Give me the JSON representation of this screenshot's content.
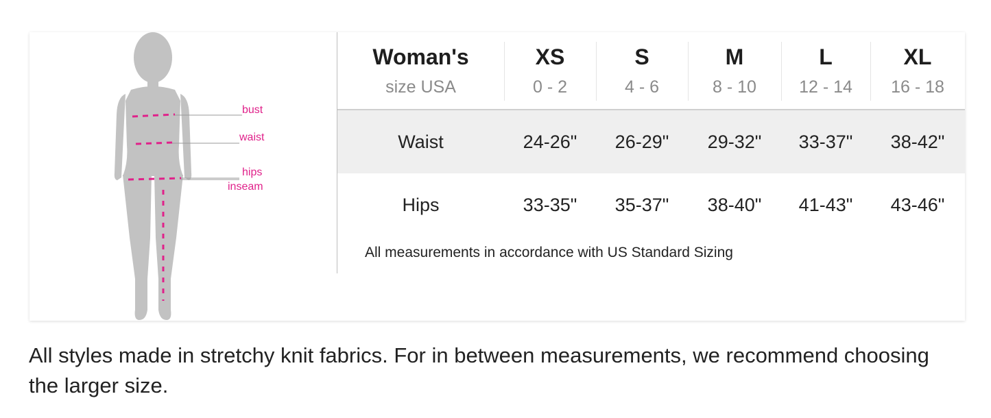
{
  "figure": {
    "labels": {
      "bust": "bust",
      "waist": "waist",
      "hips": "hips",
      "inseam": "inseam"
    },
    "colors": {
      "silhouette": "#c2c2c2",
      "marker": "#e0218a",
      "leader": "#9a9a9a"
    }
  },
  "table": {
    "header": {
      "title": "Woman's",
      "subtitle": "size USA",
      "sizes": [
        {
          "name": "XS",
          "range": "0 - 2"
        },
        {
          "name": "S",
          "range": "4 - 6"
        },
        {
          "name": "M",
          "range": "8 - 10"
        },
        {
          "name": "L",
          "range": "12 - 14"
        },
        {
          "name": "XL",
          "range": "16 - 18"
        }
      ]
    },
    "rows": [
      {
        "label": "Waist",
        "values": [
          "24-26\"",
          "26-29\"",
          "29-32\"",
          "33-37\"",
          "38-42\""
        ]
      },
      {
        "label": "Hips",
        "values": [
          "33-35\"",
          "35-37\"",
          "38-40\"",
          "41-43\"",
          "43-46\""
        ]
      }
    ],
    "note": "All measurements in accordance with US Standard Sizing"
  },
  "footer": "All styles made in stretchy knit fabrics. For in between measurements, we recommend choosing the larger size."
}
